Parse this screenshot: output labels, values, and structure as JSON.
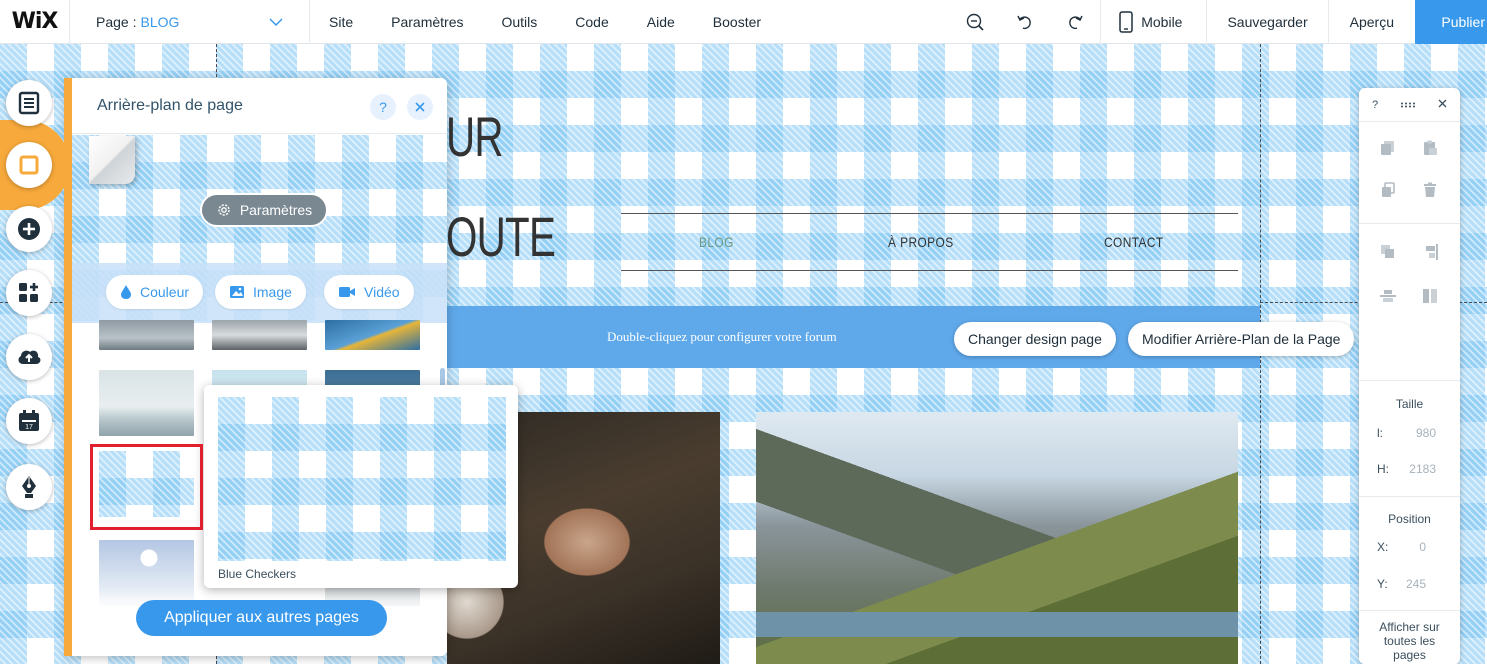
{
  "topbar": {
    "logo": "WiX",
    "page_label": "Page :",
    "page_value": "BLOG",
    "menu": [
      "Site",
      "Paramètres",
      "Outils",
      "Code",
      "Aide",
      "Booster"
    ],
    "mobile_label": "Mobile",
    "save_label": "Sauvegarder",
    "preview_label": "Aperçu",
    "publish_label": "Publier"
  },
  "site": {
    "title_line1": "UR",
    "title_line2": "OUTE",
    "nav": [
      "BLOG",
      "À PROPOS",
      "CONTACT"
    ],
    "forum_hint": "Double-cliquez pour configurer votre forum",
    "change_design_label": "Changer design page",
    "edit_bg_label": "Modifier Arrière-Plan de la Page"
  },
  "panel": {
    "title": "Arrière-plan de page",
    "settings_label": "Paramètres",
    "tabs": [
      "Couleur",
      "Image",
      "Vidéo"
    ],
    "apply_label": "Appliquer aux autres pages",
    "popup_caption": "Blue Checkers"
  },
  "inspector": {
    "help": "?",
    "size_label": "Taille",
    "width_key": "l:",
    "width_value": "980",
    "height_key": "H:",
    "height_value": "2183",
    "position_label": "Position",
    "x_key": "X:",
    "x_value": "0",
    "y_key": "Y:",
    "y_value": "245",
    "show_all_line1": "Afficher sur",
    "show_all_line2": "toutes les",
    "show_all_line3": "pages"
  },
  "colors": {
    "accent": "#3899ec",
    "active_rail": "#f7a93b",
    "highlight": "#e0202f",
    "forum_strip": "#5fa8ea"
  }
}
